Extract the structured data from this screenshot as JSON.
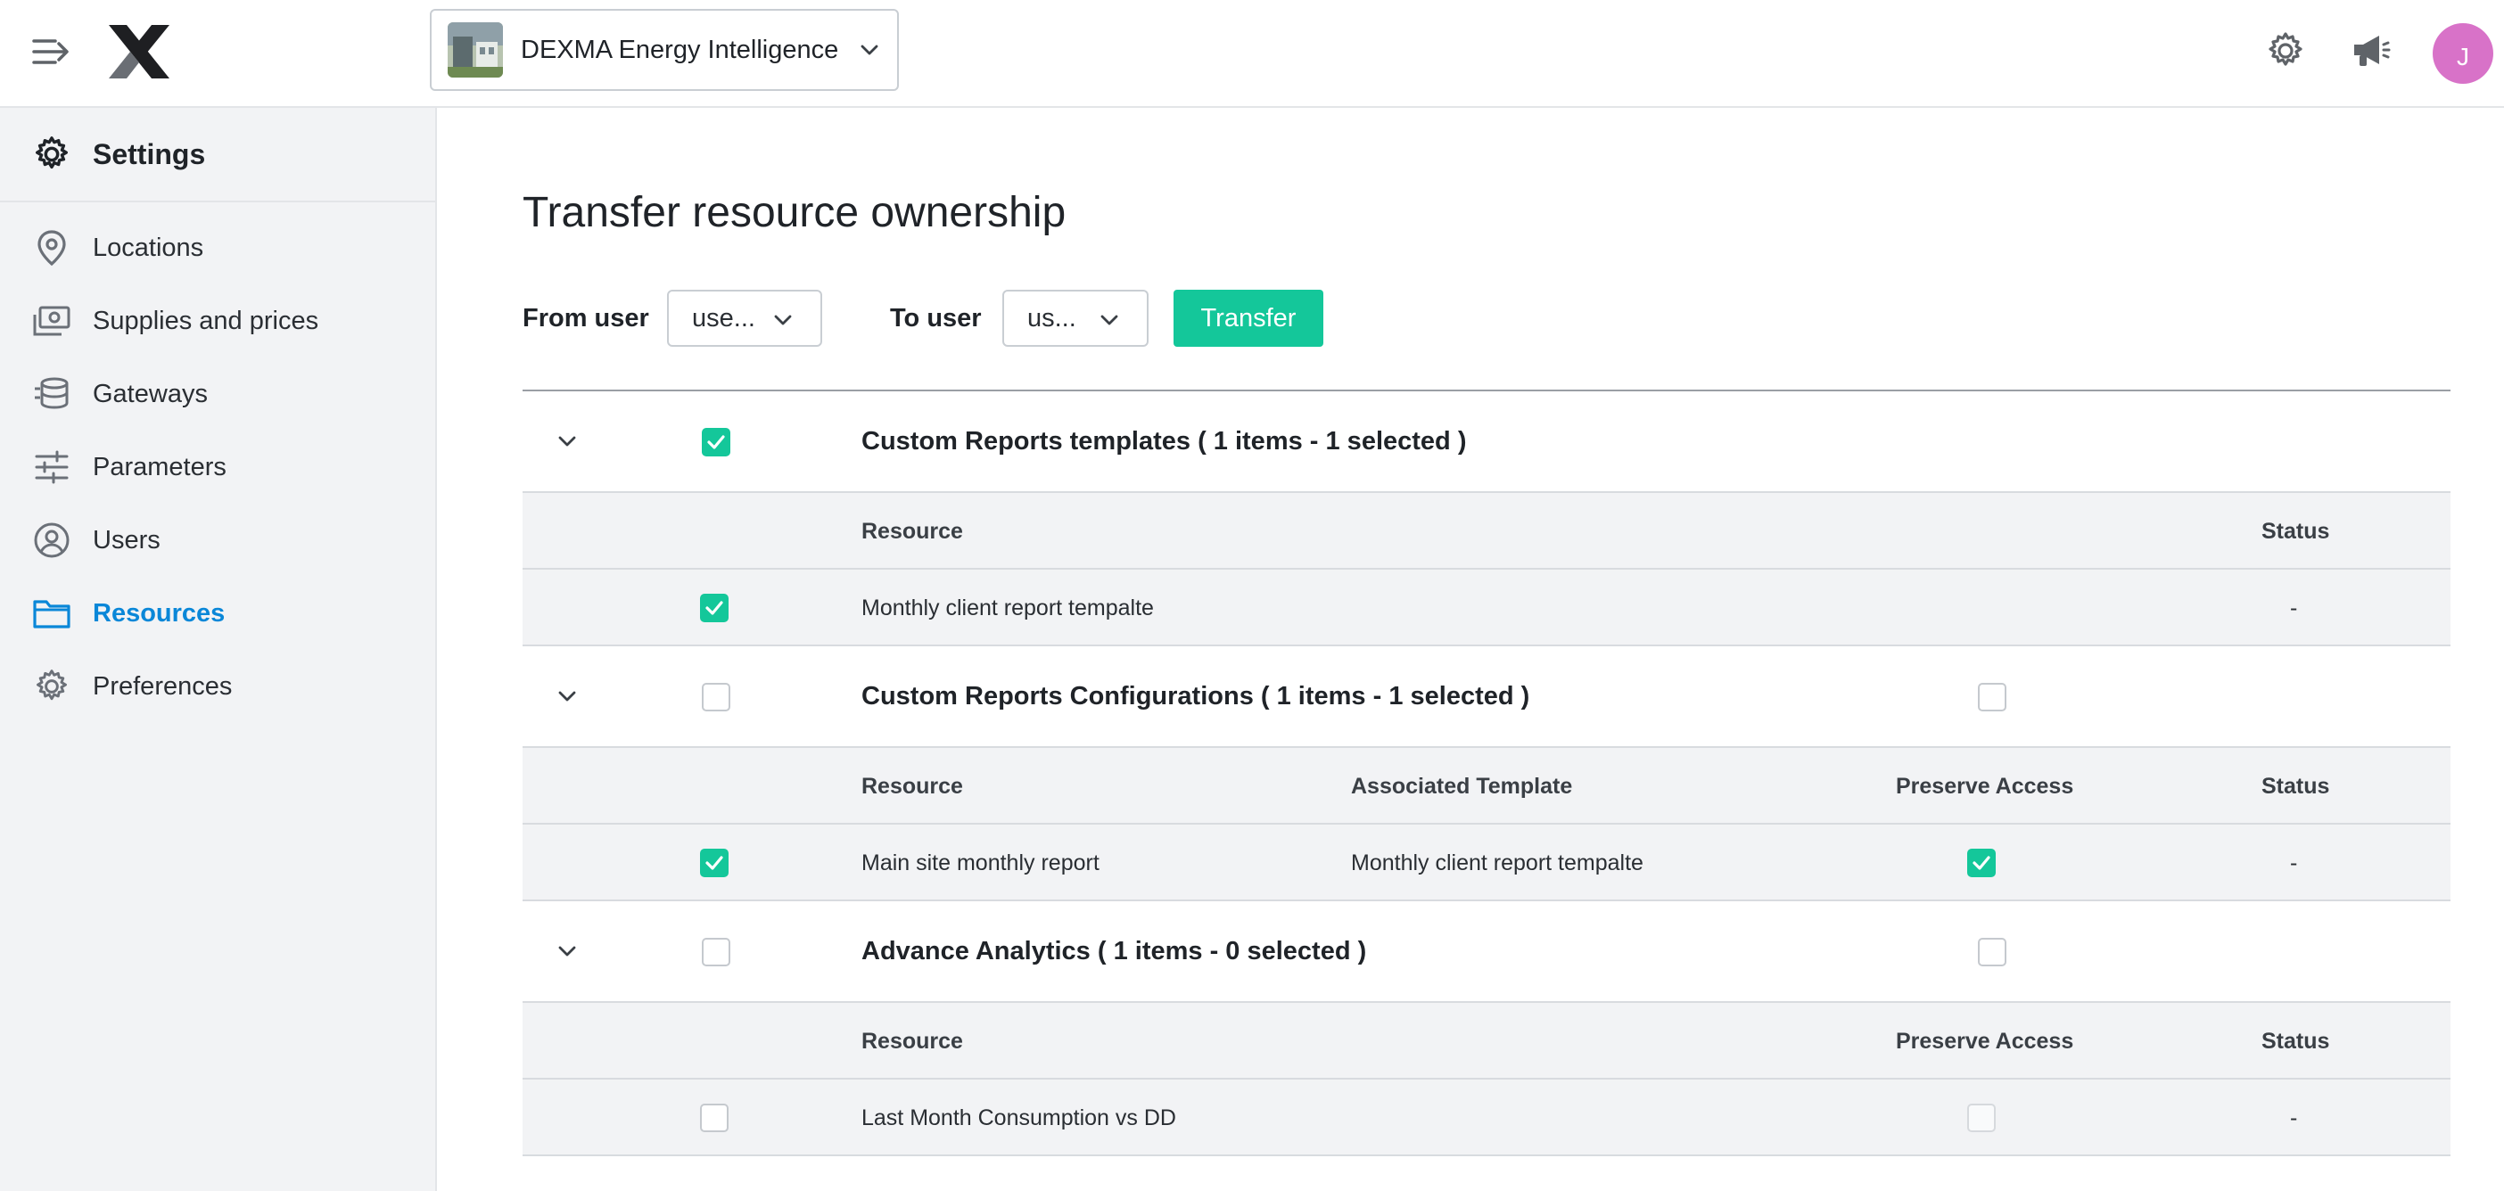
{
  "topbar": {
    "org_name": "DEXMA Energy Intelligence",
    "avatar_initial": "J"
  },
  "sidebar": {
    "title": "Settings",
    "items": [
      {
        "label": "Locations",
        "icon": "location-pin-icon",
        "active": false
      },
      {
        "label": "Supplies and prices",
        "icon": "supplies-icon",
        "active": false
      },
      {
        "label": "Gateways",
        "icon": "gateway-icon",
        "active": false
      },
      {
        "label": "Parameters",
        "icon": "sliders-icon",
        "active": false
      },
      {
        "label": "Users",
        "icon": "user-circle-icon",
        "active": false
      },
      {
        "label": "Resources",
        "icon": "folder-icon",
        "active": true
      },
      {
        "label": "Preferences",
        "icon": "gear-icon",
        "active": false
      }
    ]
  },
  "main": {
    "title": "Transfer resource ownership",
    "from_label": "From user",
    "from_value": "use...",
    "to_label": "To user",
    "to_value": "us...",
    "transfer_label": "Transfer"
  },
  "colors": {
    "accent": "#14c79a",
    "active_link": "#0a87d8",
    "avatar": "#d872c8"
  },
  "groups": [
    {
      "title": "Custom Reports templates ( 1 items - 1 selected )",
      "checked": true,
      "preserve_checkbox": false,
      "columns": {
        "resource": "Resource",
        "status": "Status"
      },
      "rows": [
        {
          "checked": true,
          "resource": "Monthly client report tempalte",
          "status": "-"
        }
      ]
    },
    {
      "title": "Custom Reports Configurations ( 1 items - 1 selected )",
      "checked": false,
      "preserve_checkbox": true,
      "preserve_checked": false,
      "columns": {
        "resource": "Resource",
        "template": "Associated Template",
        "preserve": "Preserve Access",
        "status": "Status"
      },
      "rows": [
        {
          "checked": true,
          "resource": "Main site monthly report",
          "template": "Monthly client report tempalte",
          "preserve_checked": true,
          "status": "-"
        }
      ]
    },
    {
      "title": "Advance Analytics ( 1 items - 0 selected )",
      "checked": false,
      "preserve_checkbox": true,
      "preserve_checked": false,
      "columns": {
        "resource": "Resource",
        "preserve": "Preserve Access",
        "status": "Status"
      },
      "rows": [
        {
          "checked": false,
          "resource": "Last Month Consumption vs DD",
          "preserve_checked": false,
          "status": "-"
        }
      ]
    }
  ]
}
